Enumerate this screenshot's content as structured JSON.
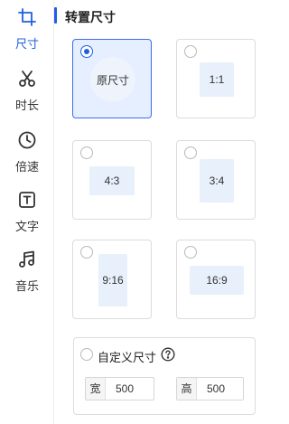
{
  "sidebar": {
    "items": [
      {
        "label": "尺寸",
        "icon": "crop-icon",
        "active": true
      },
      {
        "label": "时长",
        "icon": "scissors-icon",
        "active": false
      },
      {
        "label": "倍速",
        "icon": "clock-icon",
        "active": false
      },
      {
        "label": "文字",
        "icon": "text-icon",
        "active": false
      },
      {
        "label": "音乐",
        "icon": "music-note-icon",
        "active": false
      }
    ]
  },
  "panel": {
    "title": "转置尺寸",
    "options": [
      {
        "label": "原尺寸",
        "selected": true
      },
      {
        "label": "1:1",
        "selected": false
      },
      {
        "label": "4:3",
        "selected": false
      },
      {
        "label": "3:4",
        "selected": false
      },
      {
        "label": "9:16",
        "selected": false
      },
      {
        "label": "16:9",
        "selected": false
      }
    ],
    "custom": {
      "label": "自定义尺寸",
      "selected": false,
      "width_label": "宽",
      "width_value": "500",
      "height_label": "高",
      "height_value": "500"
    }
  },
  "colors": {
    "accent": "#1f5fe0",
    "selected_card_bg": "#e6efff",
    "ratio_box_bg": "#e7f0fb"
  }
}
